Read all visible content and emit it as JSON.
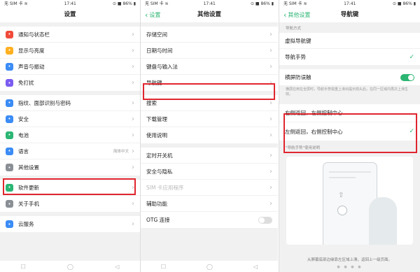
{
  "status": {
    "left": "无 SIM 卡 ≋",
    "time": "17:41",
    "right": "⊙ ■ 86% ▮"
  },
  "panel1": {
    "title": "设置",
    "groups": [
      [
        {
          "label": "通知与状态栏",
          "icon": "bell-icon",
          "color": "#f04a3a"
        },
        {
          "label": "显示与亮度",
          "icon": "sun-icon",
          "color": "#ffb020"
        },
        {
          "label": "声音与振动",
          "icon": "speaker-icon",
          "color": "#3b8cf5"
        },
        {
          "label": "免打扰",
          "icon": "moon-icon",
          "color": "#7b5cf0"
        }
      ],
      [
        {
          "label": "指纹、面部识别与密码",
          "icon": "fingerprint-icon",
          "color": "#3b8cf5"
        },
        {
          "label": "安全",
          "icon": "shield-icon",
          "color": "#3b8cf5"
        },
        {
          "label": "电池",
          "icon": "battery-icon",
          "color": "#2bb673"
        },
        {
          "label": "语言",
          "icon": "globe-icon",
          "color": "#3b8cf5",
          "value": "简体中文"
        },
        {
          "label": "其他设置",
          "icon": "gear-icon",
          "color": "#8a8f95"
        }
      ],
      [
        {
          "label": "软件更新",
          "icon": "update-icon",
          "color": "#2bb673"
        },
        {
          "label": "关于手机",
          "icon": "info-icon",
          "color": "#8a8f95"
        }
      ],
      [
        {
          "label": "云服务",
          "icon": "cloud-icon",
          "color": "#3b8cf5"
        }
      ]
    ]
  },
  "panel2": {
    "back": "设置",
    "title": "其他设置",
    "groups": [
      [
        "存储空间",
        "日期与时间",
        "键盘与输入法",
        "导航键"
      ],
      [
        "搜索",
        "下载管理",
        "使用说明"
      ],
      [
        "定时开关机",
        "安全与隐私",
        "SIM 卡应用程序",
        "辅助功能",
        "OTG 连接"
      ]
    ]
  },
  "panel3": {
    "back": "其他设置",
    "title": "导航键",
    "section1_label": "导航方式",
    "option_virtual": "虚拟导航键",
    "option_gesture": "导航手势",
    "anti_touch": "横屏防误触",
    "desc": "横屏应用在全屏时，导航手势需重上滑出提示箭头后，在同一区域内再次上滑生效。",
    "option_right_back": "右侧返回，左侧控制中心",
    "option_left_back": "左侧返回，右侧控制中心",
    "gesture_section_label": "\"导航手势\"使用说明",
    "caption": "从屏幕底部边缘靠左区域上滑，返回上一级页面。"
  }
}
